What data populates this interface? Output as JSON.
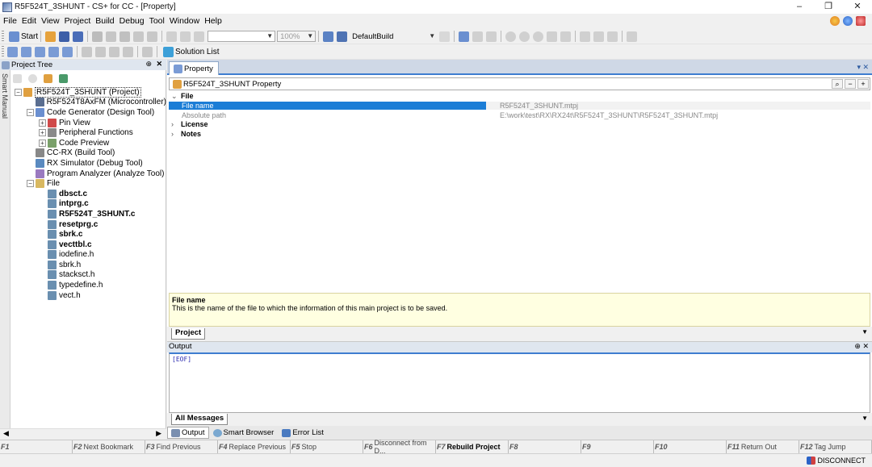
{
  "window": {
    "title": "R5F524T_3SHUNT - CS+ for CC - [Property]",
    "controls": [
      "–",
      "❐",
      "✕"
    ]
  },
  "menu": [
    "File",
    "Edit",
    "View",
    "Project",
    "Build",
    "Debug",
    "Tool",
    "Window",
    "Help"
  ],
  "toolbar": {
    "start_label": "Start",
    "zoom_value": "100%",
    "build_mode": "DefaultBuild",
    "solution_list_label": "Solution List"
  },
  "project_tree": {
    "header": "Project Tree",
    "side_tab": "Smart Manual",
    "items": [
      {
        "label": "R5F524T_3SHUNT (Project)",
        "depth": 0,
        "exp": "−",
        "icon": "project",
        "bold": false,
        "selected": true
      },
      {
        "label": "R5F524T8AxFM (Microcontroller)",
        "depth": 1,
        "exp": "",
        "icon": "chip",
        "bold": false
      },
      {
        "label": "Code Generator (Design Tool)",
        "depth": 1,
        "exp": "−",
        "icon": "codegen",
        "bold": false
      },
      {
        "label": "Pin View",
        "depth": 2,
        "exp": "+",
        "icon": "pin",
        "bold": false
      },
      {
        "label": "Peripheral Functions",
        "depth": 2,
        "exp": "+",
        "icon": "periph",
        "bold": false
      },
      {
        "label": "Code Preview",
        "depth": 2,
        "exp": "+",
        "icon": "preview",
        "bold": false
      },
      {
        "label": "CC-RX (Build Tool)",
        "depth": 1,
        "exp": "",
        "icon": "build",
        "bold": false
      },
      {
        "label": "RX Simulator (Debug Tool)",
        "depth": 1,
        "exp": "",
        "icon": "debug",
        "bold": false
      },
      {
        "label": "Program Analyzer (Analyze Tool)",
        "depth": 1,
        "exp": "",
        "icon": "analyze",
        "bold": false
      },
      {
        "label": "File",
        "depth": 1,
        "exp": "−",
        "icon": "folder",
        "bold": false
      },
      {
        "label": "dbsct.c",
        "depth": 2,
        "exp": "",
        "icon": "cfile",
        "bold": true
      },
      {
        "label": "intprg.c",
        "depth": 2,
        "exp": "",
        "icon": "cfile",
        "bold": true
      },
      {
        "label": "R5F524T_3SHUNT.c",
        "depth": 2,
        "exp": "",
        "icon": "cfile",
        "bold": true
      },
      {
        "label": "resetprg.c",
        "depth": 2,
        "exp": "",
        "icon": "cfile",
        "bold": true
      },
      {
        "label": "sbrk.c",
        "depth": 2,
        "exp": "",
        "icon": "cfile",
        "bold": true
      },
      {
        "label": "vecttbl.c",
        "depth": 2,
        "exp": "",
        "icon": "cfile",
        "bold": true
      },
      {
        "label": "iodefine.h",
        "depth": 2,
        "exp": "",
        "icon": "hfile",
        "bold": false
      },
      {
        "label": "sbrk.h",
        "depth": 2,
        "exp": "",
        "icon": "hfile",
        "bold": false
      },
      {
        "label": "stacksct.h",
        "depth": 2,
        "exp": "",
        "icon": "hfile",
        "bold": false
      },
      {
        "label": "typedefine.h",
        "depth": 2,
        "exp": "",
        "icon": "hfile",
        "bold": false
      },
      {
        "label": "vect.h",
        "depth": 2,
        "exp": "",
        "icon": "hfile",
        "bold": false
      }
    ]
  },
  "property": {
    "tab_label": "Property",
    "subject": "R5F524T_3SHUNT Property",
    "categories": [
      {
        "name": "File",
        "expanded": true,
        "rows": [
          {
            "key": "File name",
            "value": "R5F524T_3SHUNT.mtpj",
            "selected": true
          },
          {
            "key": "Absolute path",
            "value": "E:\\work\\test\\RX\\RX24t\\R5F524T_3SHUNT\\R5F524T_3SHUNT.mtpj",
            "selected": false
          }
        ]
      },
      {
        "name": "License",
        "expanded": false,
        "rows": []
      },
      {
        "name": "Notes",
        "expanded": false,
        "rows": []
      }
    ],
    "description_title": "File name",
    "description_text": "This is the name of the file to which the information of this main project is to be saved.",
    "bottom_tab": "Project"
  },
  "output": {
    "header": "Output",
    "content": "[EOF]",
    "bottom_tab": "All Messages",
    "dock_tabs": [
      "Output",
      "Smart Browser",
      "Error List"
    ]
  },
  "function_keys": [
    {
      "key": "F1",
      "label": ""
    },
    {
      "key": "F2",
      "label": "Next Bookmark"
    },
    {
      "key": "F3",
      "label": "Find Previous"
    },
    {
      "key": "F4",
      "label": "Replace Previous"
    },
    {
      "key": "F5",
      "label": "Stop"
    },
    {
      "key": "F6",
      "label": "Disconnect from D..."
    },
    {
      "key": "F7",
      "label": "Rebuild Project",
      "bold": true
    },
    {
      "key": "F8",
      "label": ""
    },
    {
      "key": "F9",
      "label": ""
    },
    {
      "key": "F10",
      "label": ""
    },
    {
      "key": "F11",
      "label": "Return Out"
    },
    {
      "key": "F12",
      "label": "Tag Jump"
    }
  ],
  "status": {
    "connection": "DISCONNECT"
  },
  "colors": {
    "accent": "#3e7dd0",
    "selection": "#1b7dd6",
    "description_bg": "#ffffe1"
  }
}
